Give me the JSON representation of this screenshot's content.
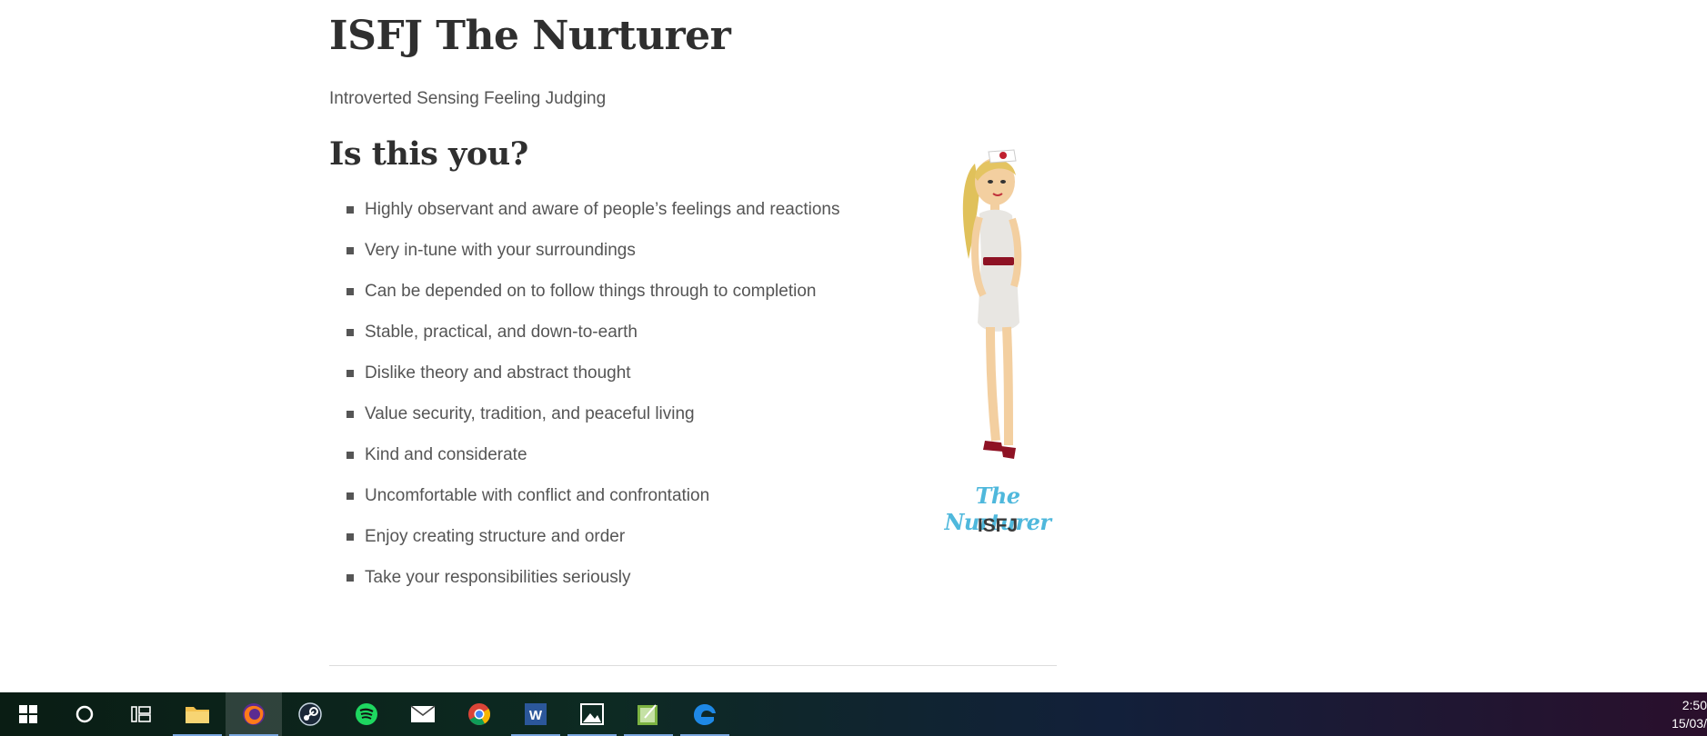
{
  "page": {
    "title": "ISFJ The Nurturer",
    "subtitle": "Introverted Sensing Feeling Judging",
    "section_heading": "Is this you?",
    "traits": [
      "Highly observant and aware of people’s feelings and reactions",
      "Very in-tune with your surroundings",
      "Can be depended on to follow things through to completion",
      "Stable, practical, and down-to-earth",
      "Dislike theory and abstract thought",
      "Value security, tradition, and peaceful living",
      "Kind and considerate",
      "Uncomfortable with conflict and confrontation",
      "Enjoy creating structure and order",
      "Take your responsibilities seriously"
    ],
    "figure": {
      "name": "The Nurturer",
      "code": "ISFJ",
      "name_color": "#4fb8dc"
    }
  },
  "taskbar": {
    "apps": [
      {
        "name": "start-icon",
        "active": false,
        "open": false
      },
      {
        "name": "cortana-icon",
        "active": false,
        "open": false
      },
      {
        "name": "task-view-icon",
        "active": false,
        "open": false
      },
      {
        "name": "file-explorer-icon",
        "active": false,
        "open": true
      },
      {
        "name": "firefox-icon",
        "active": true,
        "open": true
      },
      {
        "name": "steam-icon",
        "active": false,
        "open": false
      },
      {
        "name": "spotify-icon",
        "active": false,
        "open": false
      },
      {
        "name": "mail-icon",
        "active": false,
        "open": false
      },
      {
        "name": "chrome-icon",
        "active": false,
        "open": false
      },
      {
        "name": "word-icon",
        "active": false,
        "open": true
      },
      {
        "name": "photos-icon",
        "active": false,
        "open": true
      },
      {
        "name": "notes-app-icon",
        "active": false,
        "open": true
      },
      {
        "name": "edge-icon",
        "active": false,
        "open": true
      }
    ],
    "clock_time": "2:50",
    "clock_date": "15/03/"
  }
}
